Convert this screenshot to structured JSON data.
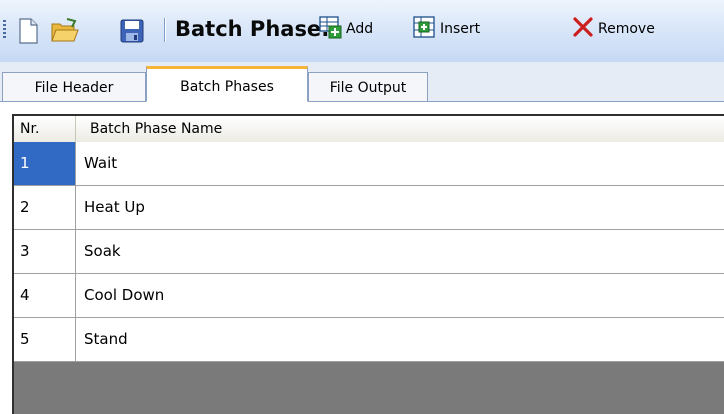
{
  "toolbar": {
    "title": "Batch Phase:",
    "buttons": [
      {
        "label": "Add",
        "icon": "add-icon"
      },
      {
        "label": "Insert",
        "icon": "insert-icon"
      },
      {
        "label": "Remove",
        "icon": "remove-icon"
      }
    ],
    "file_icons": [
      "new-file-icon",
      "open-folder-icon",
      "save-disk-icon"
    ]
  },
  "tabs": [
    {
      "label": "File Header"
    },
    {
      "label": "Batch Phases"
    },
    {
      "label": "File Output"
    }
  ],
  "active_tab": "Batch Phases",
  "grid": {
    "columns": [
      "Nr.",
      "Batch Phase Name"
    ],
    "rows": [
      {
        "nr": "1",
        "name": "Wait"
      },
      {
        "nr": "2",
        "name": "Heat Up"
      },
      {
        "nr": "3",
        "name": "Soak"
      },
      {
        "nr": "4",
        "name": "Cool Down"
      },
      {
        "nr": "5",
        "name": "Stand"
      }
    ],
    "selected_row": 1
  },
  "colors": {
    "selection": "#316ac5",
    "active_tab_accent": "#f5b43a",
    "remove_icon": "#cc1f1f",
    "empty_area": "#7a7a7a"
  }
}
